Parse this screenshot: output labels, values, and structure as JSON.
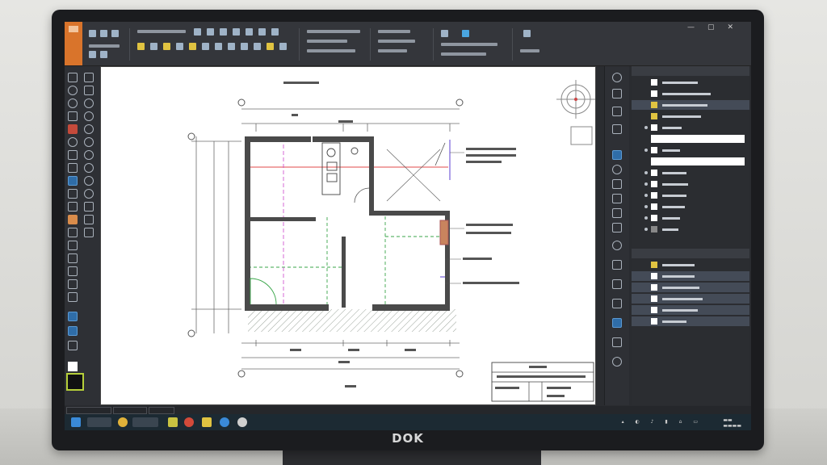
{
  "monitor": {
    "brand": "DOK"
  },
  "window": {
    "controls": [
      "—",
      "▢",
      "✕"
    ]
  },
  "icons": {
    "app": "app-menu-icon",
    "start": "windows-start-icon",
    "browser": "chrome-icon",
    "explorer": "folder-icon",
    "cad": "cad-app-icon"
  },
  "colors": {
    "ribbon": "#34363b",
    "app_button": "#d9742b",
    "canvas": "#ffffff",
    "wall": "#4a4a4a",
    "dim_line": "#6b6b6b",
    "red_guide": "#e04a4a",
    "magenta_guide": "#cc44cc",
    "green_guide": "#3aa64a",
    "purple_line": "#5b3fd1",
    "hatch": "#9aa39a",
    "highlight": "#2f6da8"
  }
}
